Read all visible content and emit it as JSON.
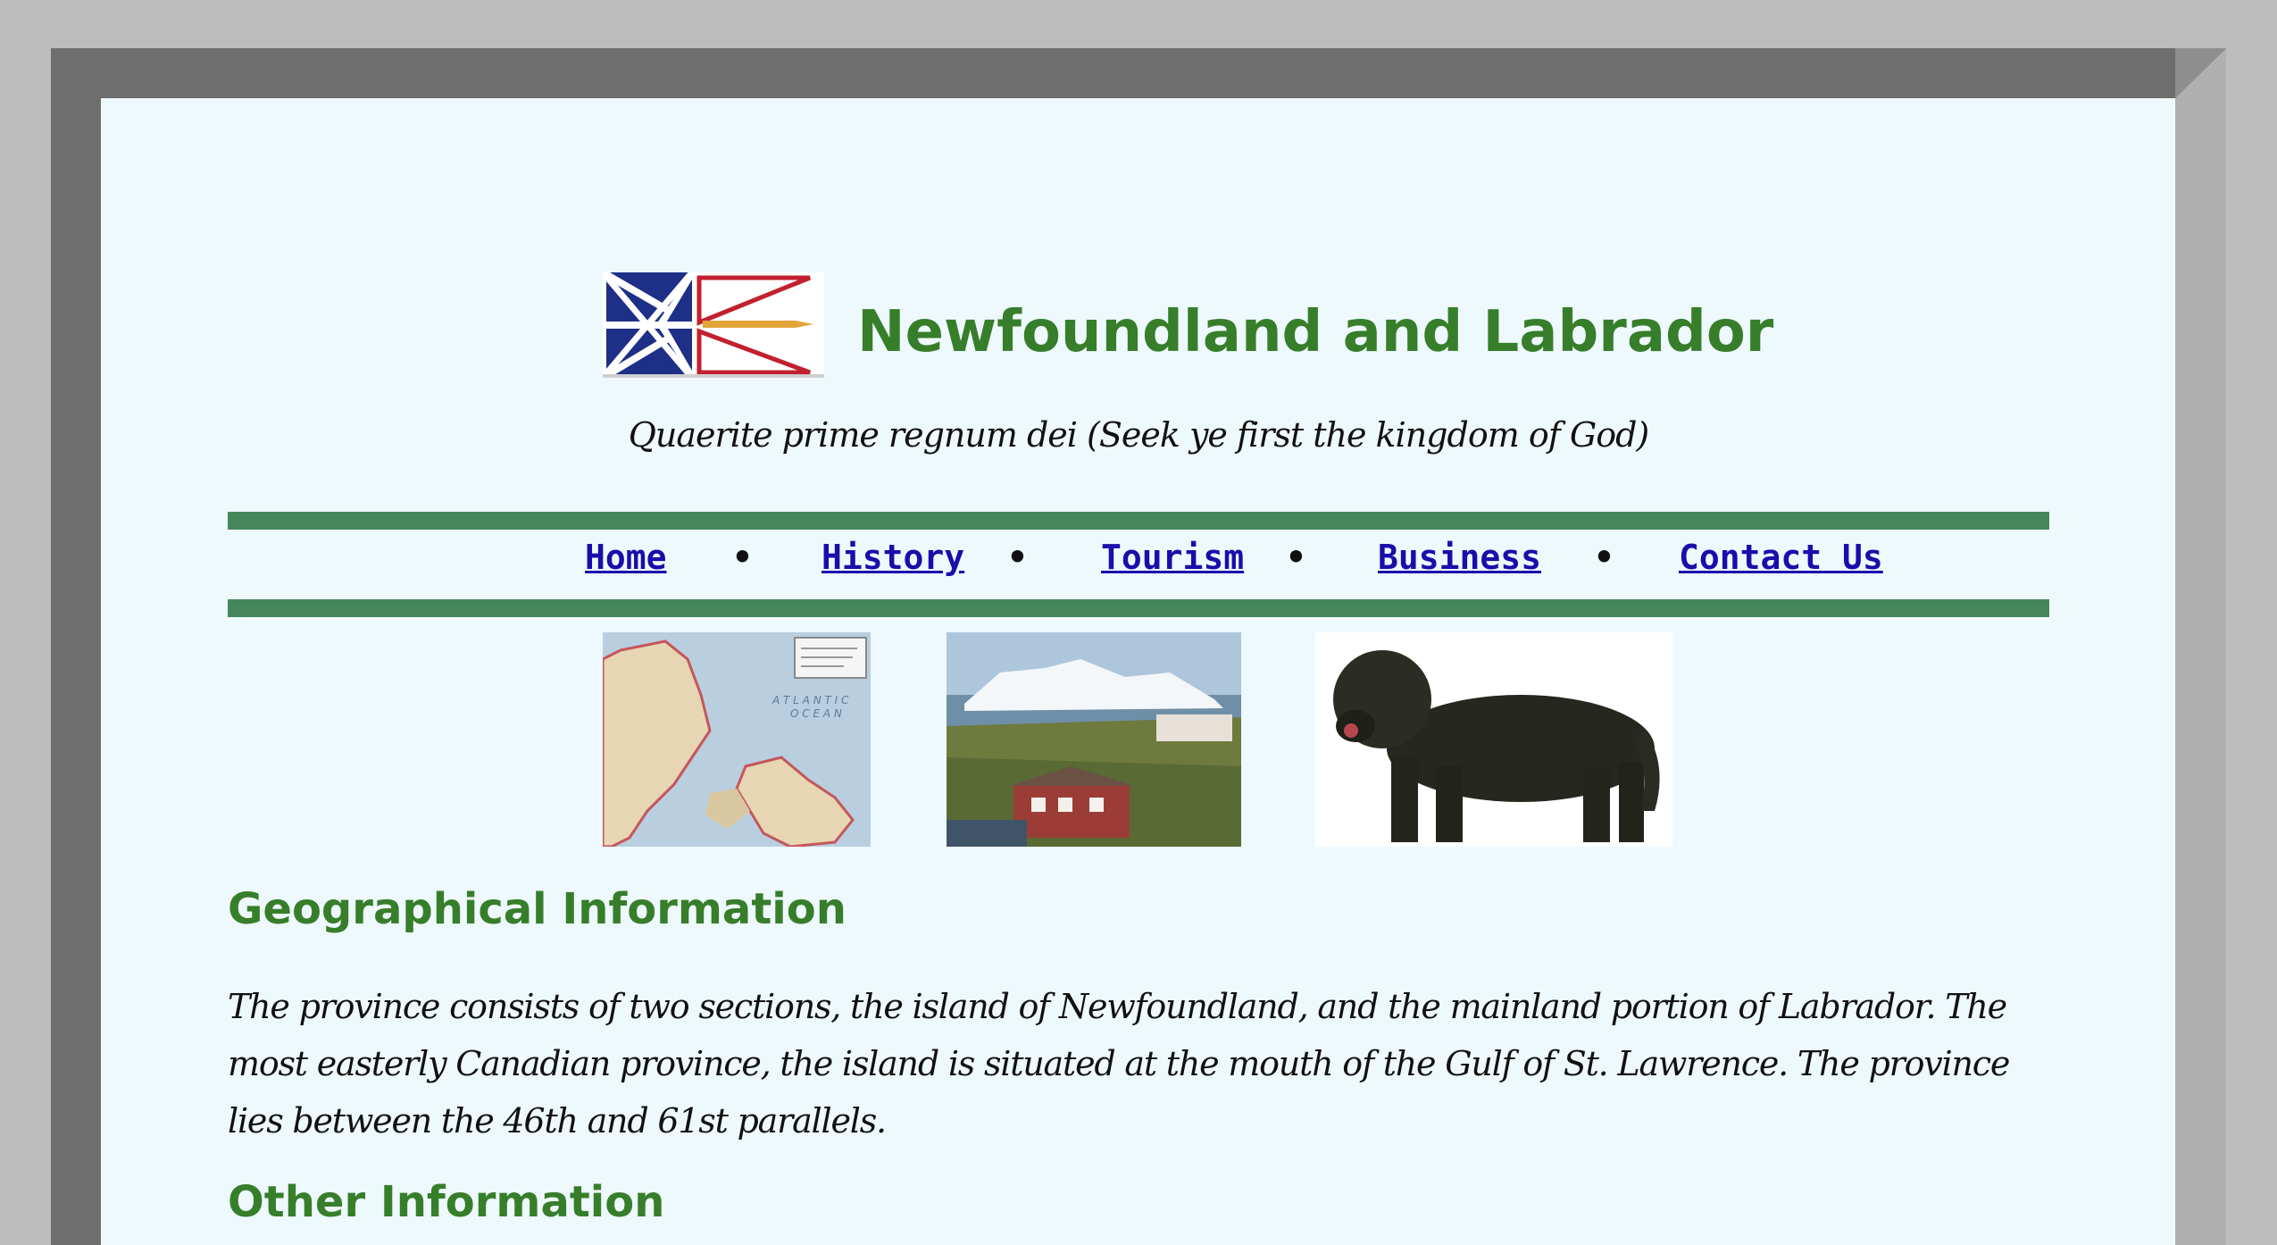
{
  "header": {
    "title": "Newfoundland and Labrador",
    "motto": "Quaerite prime regnum dei (Seek ye first the kingdom of God)"
  },
  "nav": {
    "items": [
      {
        "label": "Home"
      },
      {
        "label": "History"
      },
      {
        "label": "Tourism"
      },
      {
        "label": "Business"
      },
      {
        "label": "Contact Us"
      }
    ],
    "separator": "•"
  },
  "sections": [
    {
      "heading": "Geographical Information",
      "body": "The province consists of two sections, the island of Newfoundland, and the mainland portion of Labrador. The most easterly Canadian province, the island is situated at the mouth of the Gulf of St. Lawrence. The province lies between the 46th and 61st parallels."
    },
    {
      "heading": "Other Information"
    }
  ],
  "images": [
    {
      "icon": "province-map-image"
    },
    {
      "icon": "iceberg-village-image"
    },
    {
      "icon": "newfoundland-dog-image"
    }
  ],
  "colors": {
    "heading": "#377e2a",
    "nav_rule": "#46875a",
    "link": "#1a0dab",
    "page_bg": "#eef9fe"
  }
}
